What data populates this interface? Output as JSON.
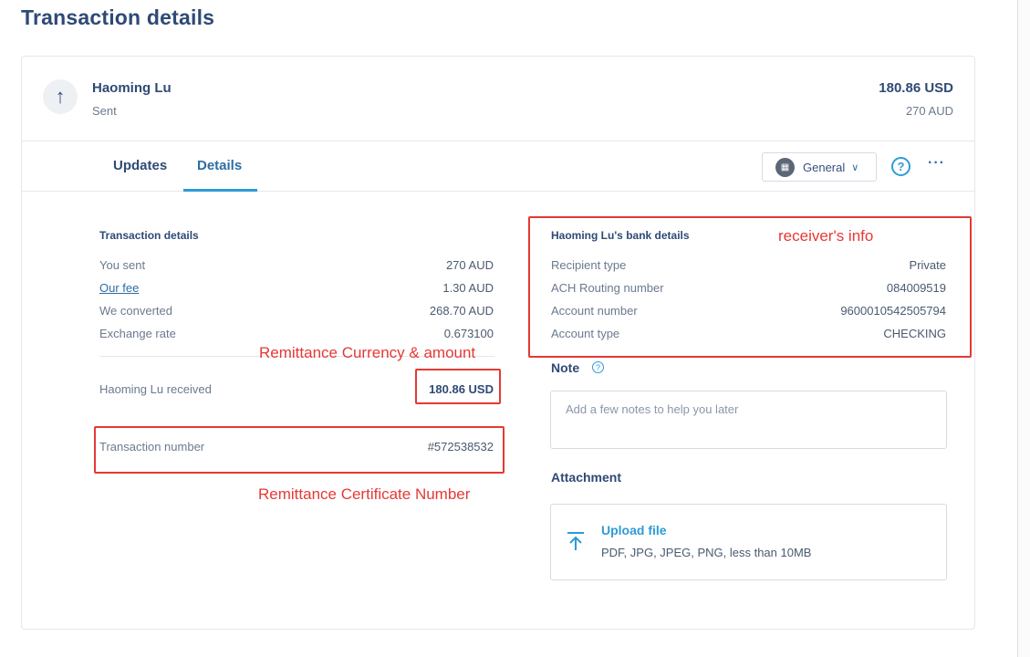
{
  "page": {
    "title": "Transaction details"
  },
  "summary": {
    "recipient": "Haoming Lu",
    "status": "Sent",
    "amount_primary": "180.86 USD",
    "amount_secondary": "270 AUD",
    "direction_icon": "arrow-up-icon"
  },
  "tabs": {
    "updates": "Updates",
    "details": "Details",
    "active": "Details"
  },
  "toolbar": {
    "select_label": "General",
    "select_icon": "grid-icon",
    "help_symbol": "?",
    "more_symbol": "···"
  },
  "transaction": {
    "title": "Transaction details",
    "rows": [
      {
        "label": "You sent",
        "value": "270 AUD"
      },
      {
        "label": "Our fee",
        "value": "1.30 AUD"
      },
      {
        "label": "We converted",
        "value": "268.70 AUD"
      },
      {
        "label": "Exchange rate",
        "value": "0.673100"
      }
    ],
    "received_label": "Haoming Lu received",
    "received_value": "180.86 USD",
    "number_label": "Transaction number",
    "number_value": "#572538532"
  },
  "bank": {
    "title": "Haoming Lu's bank details",
    "rows": [
      {
        "label": "Recipient type",
        "value": "Private"
      },
      {
        "label": "ACH Routing number",
        "value": "084009519"
      },
      {
        "label": "Account number",
        "value": "9600010542505794"
      },
      {
        "label": "Account type",
        "value": "CHECKING"
      }
    ]
  },
  "note": {
    "label": "Note",
    "placeholder": "Add a few notes to help you later"
  },
  "attachment": {
    "label": "Attachment",
    "upload_title": "Upload file",
    "upload_hint": "PDF, JPG, JPEG, PNG, less than 10MB"
  },
  "annotations": {
    "receiver": "receiver's info",
    "currency": "Remittance Currency & amount",
    "certificate": "Remittance Certificate Number"
  },
  "colors": {
    "accent": "#2e9bd6",
    "annotation": "#e53935",
    "heading": "#2e4a75"
  }
}
